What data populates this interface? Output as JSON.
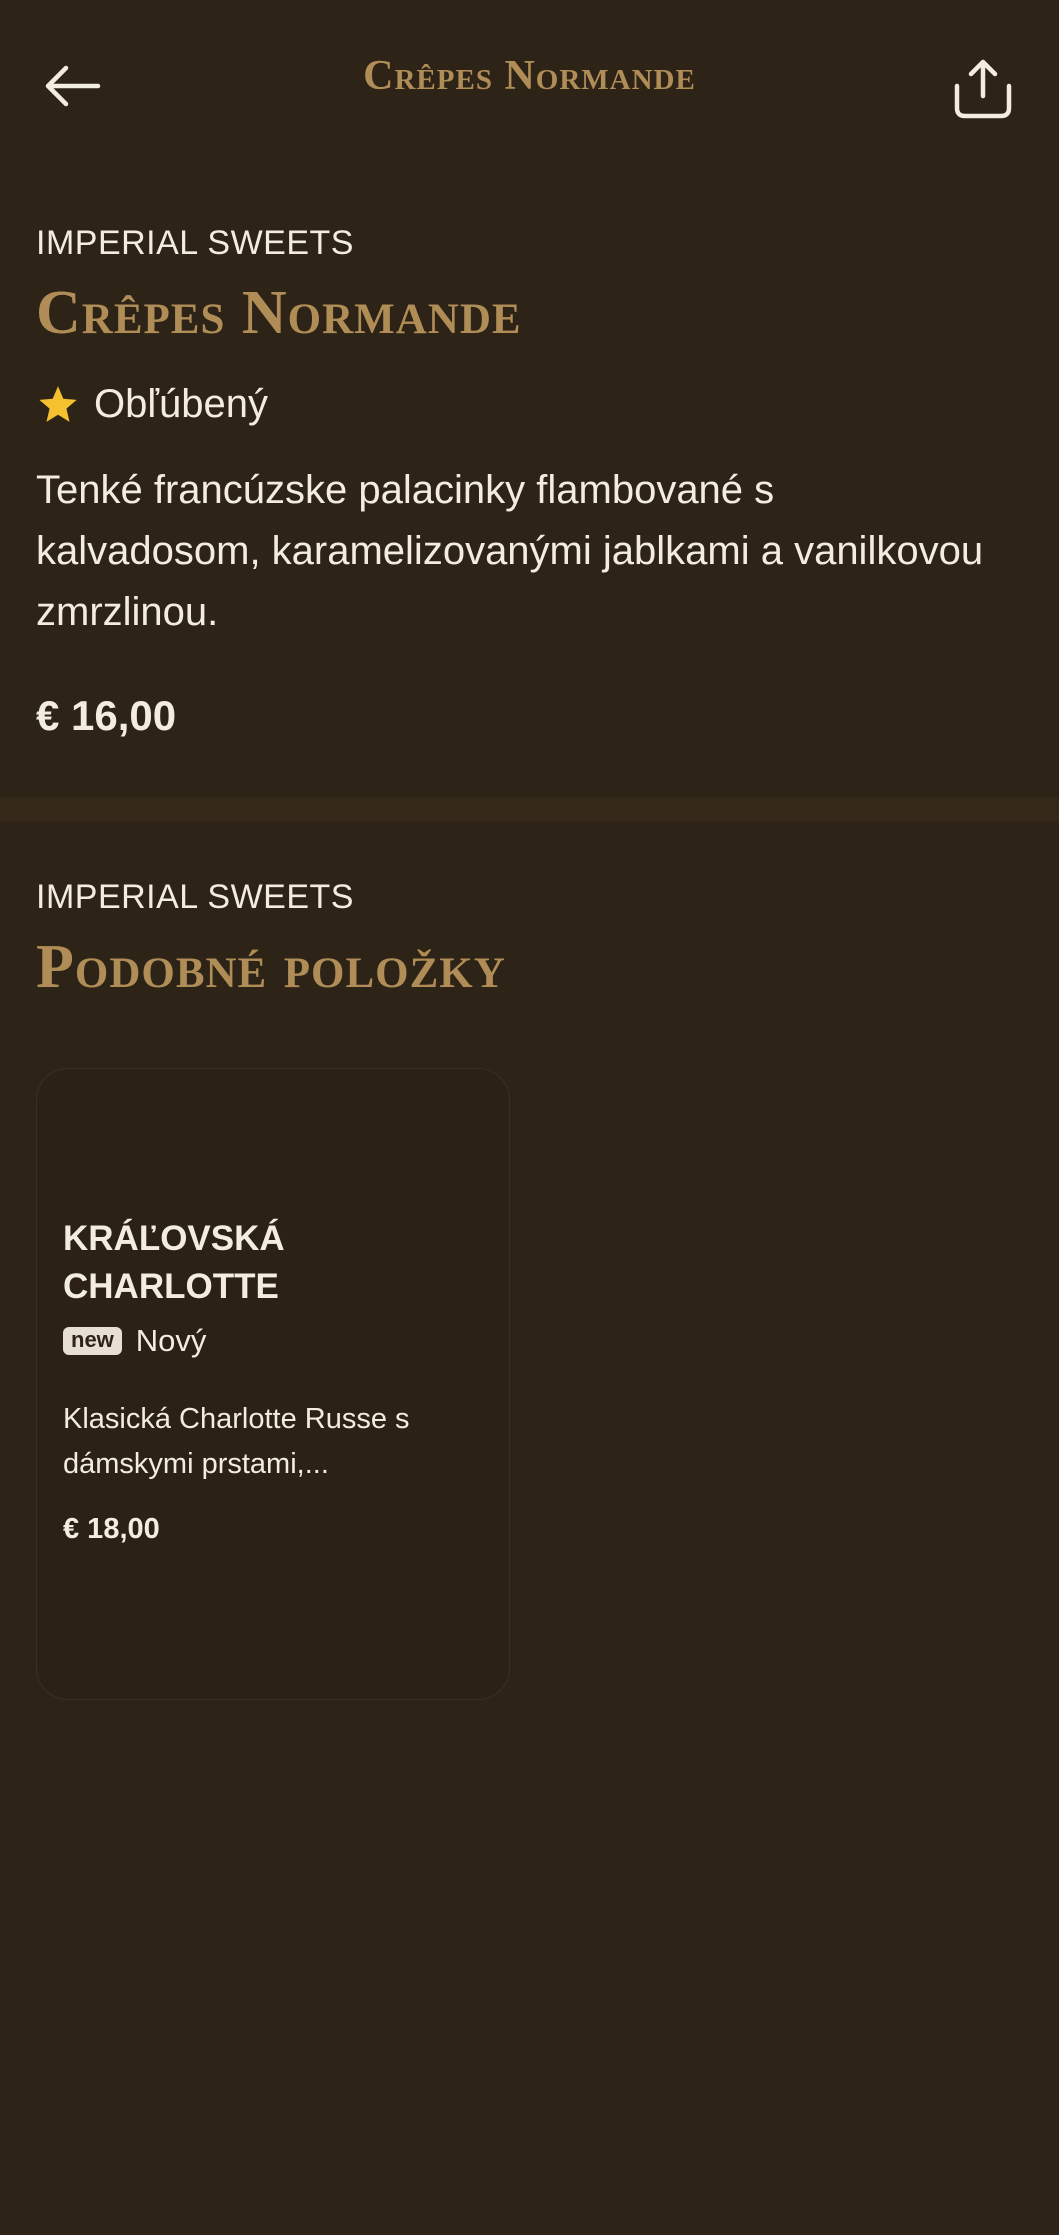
{
  "header": {
    "title": "Crêpes Normande"
  },
  "detail": {
    "brand": "IMPERIAL SWEETS",
    "name": "Crêpes Normande",
    "badge_label": "Obľúbený",
    "description": "Tenké francúzske palacinky flambované s kalvadosom, karamelizovanými jablkami a vanilkovou zmrzlinou.",
    "price": "€ 16,00"
  },
  "similar": {
    "brand": "IMPERIAL SWEETS",
    "title": "Podobné položky",
    "items": [
      {
        "name": "Kráľovská Charlotte",
        "tag": "new",
        "badge_label": "Nový",
        "description": "Klasická Charlotte Russe s dámskymi prstami,...",
        "price": "€ 18,00"
      }
    ]
  },
  "icons": {
    "back": "arrow-left-icon",
    "share": "share-icon",
    "popular": "star-icon"
  },
  "colors": {
    "background": "#2d2317",
    "accent_gold": "#b08d57",
    "star": "#f5c12e",
    "text": "#f3ece0"
  }
}
